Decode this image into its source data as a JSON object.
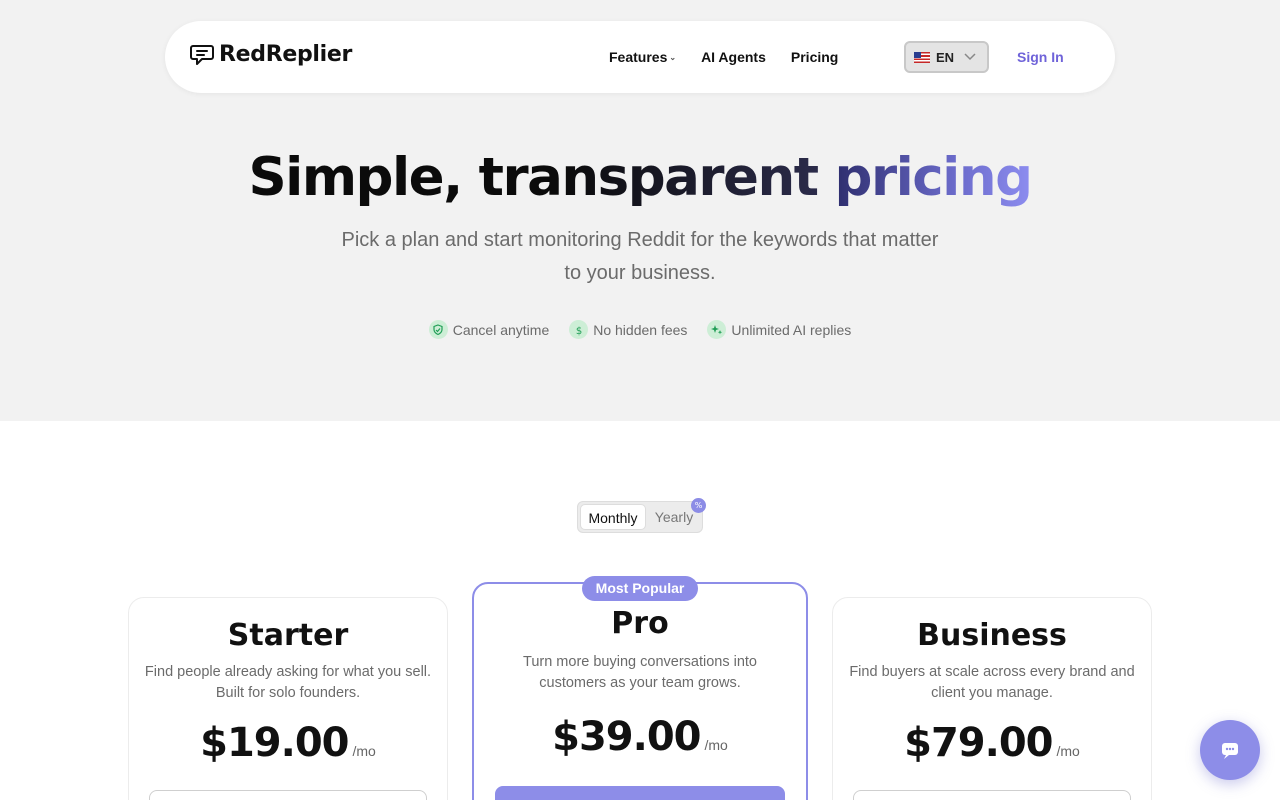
{
  "brand": {
    "name": "RedReplier",
    "icon": "chat-bubble-logo-icon"
  },
  "nav": {
    "features": "Features",
    "ai_agents": "AI Agents",
    "pricing": "Pricing",
    "language": "EN",
    "sign_in": "Sign In"
  },
  "hero": {
    "title_plain": "Simple, transparent",
    "title_accent": "pricing",
    "subtitle": "Pick a plan and start monitoring Reddit for the keywords that matter to your business.",
    "badges": [
      {
        "label": "Cancel anytime",
        "icon": "shield-check-icon"
      },
      {
        "label": "No hidden fees",
        "icon": "dollar-icon"
      },
      {
        "label": "Unlimited AI replies",
        "icon": "sparkles-icon"
      }
    ]
  },
  "billing": {
    "monthly": "Monthly",
    "yearly": "Yearly",
    "discount_icon": "%"
  },
  "plans": [
    {
      "name": "Starter",
      "description": "Find people already asking for what you sell. Built for solo founders.",
      "price": "$19.00",
      "period": "/mo"
    },
    {
      "name": "Pro",
      "badge": "Most Popular",
      "description": "Turn more buying conversations into customers as your team grows.",
      "price": "$39.00",
      "period": "/mo"
    },
    {
      "name": "Business",
      "description": "Find buyers at scale across every brand and client you manage.",
      "price": "$79.00",
      "period": "/mo"
    }
  ],
  "colors": {
    "accent": "#8d8de8",
    "link": "#6f63d9",
    "hero_bg": "#f2f2f2",
    "badge_bg": "#cdeed6",
    "badge_fg": "#1f9d55"
  }
}
